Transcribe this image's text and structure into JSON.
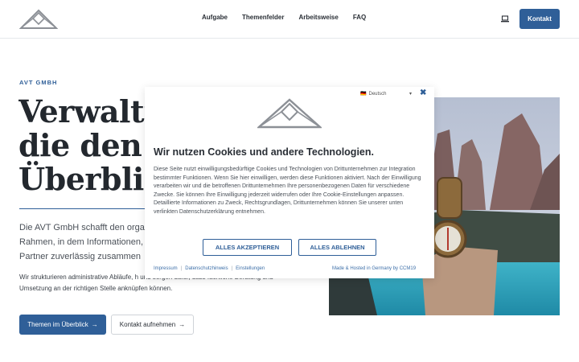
{
  "header": {
    "nav": [
      "Aufgabe",
      "Themenfelder",
      "Arbeitsweise",
      "FAQ"
    ],
    "contact_label": "Kontakt"
  },
  "hero": {
    "eyebrow": "AVT GMBH",
    "title_lines": [
      "Verwaltu",
      "die den",
      "Überblic"
    ],
    "lead_lines": [
      "Die AVT GmbH schafft den orga",
      "Rahmen, in dem Informationen,",
      "Partner zuverlässig zusammen"
    ],
    "body": "Wir strukturieren administrative Abläufe, h und sorgen dafür, dass fachliche Beratung und Umsetzung an der richtigen Stelle anknüpfen können.",
    "primary_button": "Themen im Überblick",
    "secondary_button": "Kontakt aufnehmen"
  },
  "cookie": {
    "language": "Deutsch",
    "title": "Wir nutzen Cookies und andere Technologien.",
    "text": "Diese Seite nutzt einwilligungsbedürftige Cookies und Technologien von Drittunternehmen zur Integration bestimmter Funktionen. Wenn Sie hier einwilligen, werden diese Funktionen aktiviert. Nach der Einwilligung verarbeiten wir und die betroffenen Drittunternehmen Ihre personenbezogenen Daten für verschiedene Zwecke. Sie können Ihre Einwilligung jederzeit widerrufen oder Ihre Cookie-Einstellungen anpassen. Detaillierte Informationen zu Zweck, Rechtsgrundlagen, Drittunternehmen können Sie unserer unten verlinkten Datenschutzerklärung entnehmen.",
    "accept": "ALLES AKZEPTIEREN",
    "reject": "ALLES ABLEHNEN",
    "links": [
      "Impressum",
      "Datenschutzhinweis",
      "Einstellungen"
    ],
    "hosted": "Made & Hosted in Germany by CCM19"
  },
  "colors": {
    "brand": "#2f5f98",
    "text": "#2a2f36"
  },
  "icons": [
    "logo-triangle",
    "laptop-icon",
    "arrow-right-icon",
    "language-flag-icon",
    "close-icon"
  ]
}
